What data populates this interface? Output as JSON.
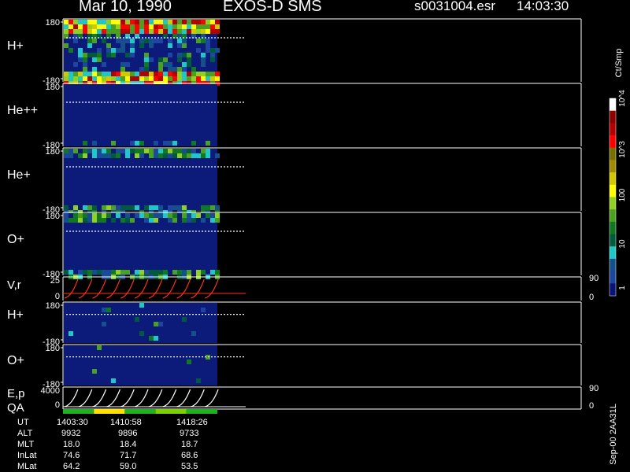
{
  "header": {
    "date": "Mar 10, 1990",
    "mission": "EXOS-D SMS",
    "file": "s0031004.esr",
    "time": "14:03:30"
  },
  "colorbar": {
    "unit": "Ct/Smp",
    "tick_labels": [
      "10^4",
      "10^3",
      "100",
      "10",
      "1"
    ],
    "colors": [
      "#ffffff",
      "#8c0000",
      "#b40000",
      "#ff0000",
      "#7a6e00",
      "#a08c00",
      "#d2c800",
      "#ffff00",
      "#90d020",
      "#4ca020",
      "#107820",
      "#005a3c",
      "#1ec8c8",
      "#14508c",
      "#1e46a0",
      "#0a1478"
    ]
  },
  "side_note": "Sep-00 2AA31L",
  "chart_data": [
    {
      "type": "heatmap",
      "name": "H+",
      "ylabel": "H+",
      "ylim": [
        -180,
        180
      ],
      "tick_labels": [
        "180",
        "-180"
      ],
      "data_end_fraction": 0.36,
      "reference_line": "dotted"
    },
    {
      "type": "heatmap",
      "name": "He++",
      "ylabel": "He++",
      "ylim": [
        -180,
        180
      ],
      "tick_labels": [
        "180",
        "-180"
      ],
      "data_end_fraction": 0.36,
      "reference_line": "dotted"
    },
    {
      "type": "heatmap",
      "name": "He+",
      "ylabel": "He+",
      "ylim": [
        -180,
        180
      ],
      "tick_labels": [
        "180",
        "-180"
      ],
      "data_end_fraction": 0.36,
      "reference_line": "dotted"
    },
    {
      "type": "heatmap",
      "name": "O+",
      "ylabel": "O+",
      "ylim": [
        -180,
        180
      ],
      "tick_labels": [
        "180",
        "-180"
      ],
      "data_end_fraction": 0.36,
      "reference_line": "dotted"
    },
    {
      "type": "line",
      "name": "V,r",
      "ylabel": "V,r",
      "ylim_left": [
        0,
        25
      ],
      "tick_labels_left": [
        "25",
        "0"
      ],
      "tick_labels_right": [
        "90",
        "0"
      ],
      "sawtooth_cycles": 11,
      "series_color": "#ff3020"
    },
    {
      "type": "heatmap",
      "name": "H+ (2)",
      "ylabel": "H+",
      "ylim": [
        -180,
        180
      ],
      "tick_labels": [
        "180",
        "-180"
      ],
      "data_end_fraction": 0.36,
      "reference_line": "dotted"
    },
    {
      "type": "heatmap",
      "name": "O+ (2)",
      "ylabel": "O+",
      "ylim": [
        -180,
        180
      ],
      "tick_labels": [
        "180",
        "-180"
      ],
      "data_end_fraction": 0.36,
      "reference_line": "dotted"
    },
    {
      "type": "line",
      "name": "E,p",
      "ylabel": "E,p",
      "ylim_left": [
        0,
        4000
      ],
      "tick_labels_left": [
        "4000",
        "0"
      ],
      "tick_labels_right": [
        "90",
        "0"
      ],
      "sawtooth_cycles": 11,
      "series_color": "#ffffff"
    }
  ],
  "qa": {
    "label": "QA",
    "colors": [
      "#20b020",
      "#ffe000",
      "#20b020",
      "#7cd000",
      "#20b020"
    ]
  },
  "ephemeris": {
    "labels": [
      "UT",
      "ALT",
      "MLT",
      "InLat",
      "MLat"
    ],
    "columns": [
      {
        "UT": "1403:30",
        "ALT": "9932",
        "MLT": "18.0",
        "InLat": "74.6",
        "MLat": "64.2"
      },
      {
        "UT": "1410:58",
        "ALT": "9896",
        "MLT": "18.4",
        "InLat": "71.7",
        "MLat": "59.0"
      },
      {
        "UT": "1418:26",
        "ALT": "9733",
        "MLT": "18.7",
        "InLat": "68.6",
        "MLat": "53.5"
      }
    ]
  }
}
